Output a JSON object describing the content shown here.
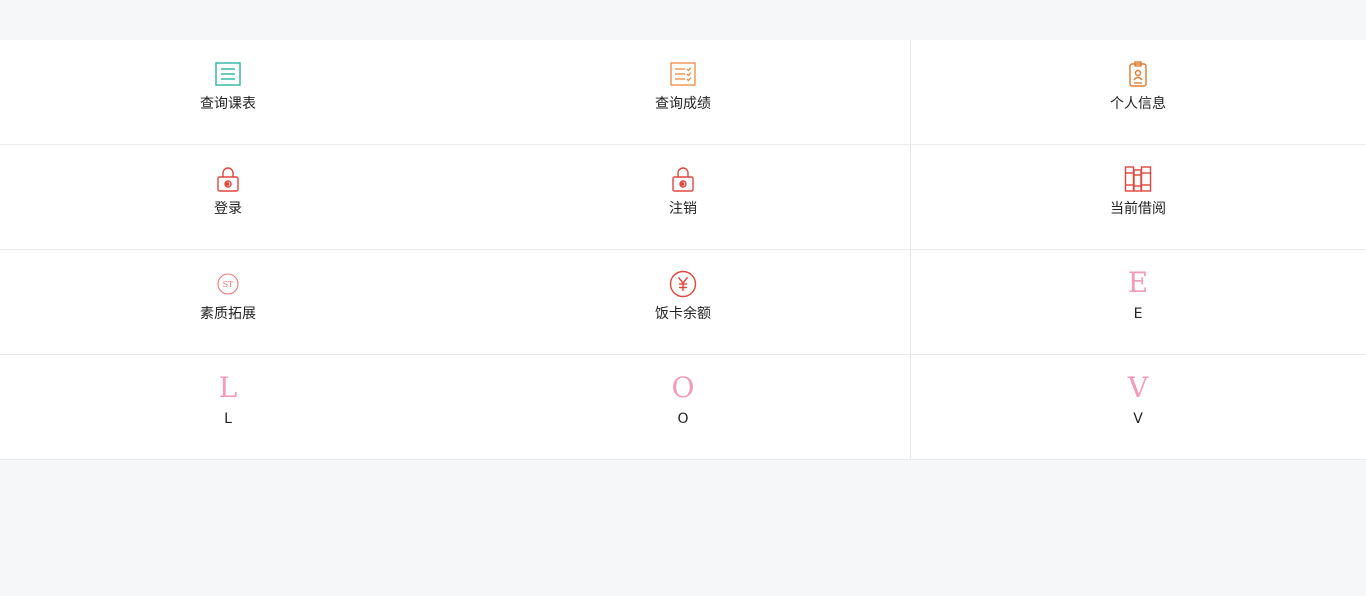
{
  "menu": {
    "items": [
      {
        "label": "查询课表",
        "icon": "list-icon",
        "color": "#2bb3a3"
      },
      {
        "label": "查询成绩",
        "icon": "checklist-icon",
        "color": "#f0883e"
      },
      {
        "label": "个人信息",
        "icon": "id-badge-icon",
        "color": "#e07a2f"
      },
      {
        "label": "登录",
        "icon": "lock-icon",
        "color": "#e0463c"
      },
      {
        "label": "注销",
        "icon": "lock-icon",
        "color": "#e0463c"
      },
      {
        "label": "当前借阅",
        "icon": "books-icon",
        "color": "#e0463c"
      },
      {
        "label": "素质拓展",
        "icon": "coin-icon",
        "color": "#f07b7b"
      },
      {
        "label": "饭卡余额",
        "icon": "yen-icon",
        "color": "#e0463c"
      },
      {
        "label": "E",
        "letter": "E",
        "color": "#f59ab8"
      },
      {
        "label": "L",
        "letter": "L",
        "color": "#f59ab8"
      },
      {
        "label": "O",
        "letter": "O",
        "color": "#f59ab8"
      },
      {
        "label": "V",
        "letter": "V",
        "color": "#f59ab8"
      }
    ]
  }
}
